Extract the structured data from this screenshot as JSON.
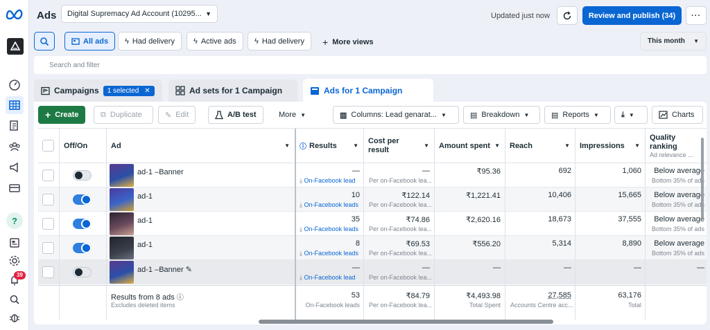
{
  "header": {
    "title": "Ads",
    "account": "Digital Supremacy Ad Account (10295...",
    "updated": "Updated just now",
    "review_label": "Review and publish (34)",
    "more_label": "···"
  },
  "sidebar": {
    "notification_count": "39",
    "help_label": "?"
  },
  "views": {
    "chips": [
      "All ads",
      "Had delivery",
      "Active ads",
      "Had delivery"
    ],
    "more_views": "More views",
    "date_range": "This month"
  },
  "search": {
    "placeholder": "Search and filter"
  },
  "tabs": {
    "campaigns": "Campaigns",
    "selected": "1 selected",
    "adsets": "Ad sets for 1 Campaign",
    "ads": "Ads for 1 Campaign"
  },
  "toolbar": {
    "create": "Create",
    "duplicate": "Duplicate",
    "edit": "Edit",
    "ab_test": "A/B test",
    "more": "More",
    "columns": "Columns: Lead genarat...",
    "breakdown": "Breakdown",
    "reports": "Reports",
    "charts": "Charts"
  },
  "table": {
    "headers": {
      "off_on": "Off/On",
      "ad": "Ad",
      "results": "Results",
      "cost_per_result": "Cost per result",
      "amount_spent": "Amount spent",
      "reach": "Reach",
      "impressions": "Impressions",
      "quality": "Quality ranking",
      "quality_sub": "Ad relevance ..."
    },
    "rows": [
      {
        "on": false,
        "name": "ad-1 –Banner",
        "results": "—",
        "results_sub": "On-Facebook lead",
        "cpr": "—",
        "cpr_sub": "Per on-Facebook lea...",
        "spent": "₹95.36",
        "reach": "692",
        "impressions": "1,060",
        "quality": "Below average",
        "quality_sub": "Bottom 35% of ads"
      },
      {
        "on": true,
        "name": "ad-1",
        "results": "10",
        "results_sub": "On-Facebook leads",
        "cpr": "₹122.14",
        "cpr_sub": "Per on-Facebook lea...",
        "spent": "₹1,221.41",
        "reach": "10,406",
        "impressions": "15,665",
        "quality": "Below average",
        "quality_sub": "Bottom 35% of ads"
      },
      {
        "on": true,
        "name": "ad-1",
        "results": "35",
        "results_sub": "On-Facebook leads",
        "cpr": "₹74.86",
        "cpr_sub": "Per on-Facebook lea...",
        "spent": "₹2,620.16",
        "reach": "18,673",
        "impressions": "37,555",
        "quality": "Below average",
        "quality_sub": "Bottom 35% of ads"
      },
      {
        "on": true,
        "name": "ad-1",
        "results": "8",
        "results_sub": "On-Facebook leads",
        "cpr": "₹69.53",
        "cpr_sub": "Per on-Facebook lea...",
        "spent": "₹556.20",
        "reach": "5,314",
        "impressions": "8,890",
        "quality": "Below average",
        "quality_sub": "Bottom 35% of ads"
      },
      {
        "on": false,
        "name": "ad-1 –Banner",
        "results": "—",
        "results_sub": "On-Facebook lead",
        "cpr": "—",
        "cpr_sub": "Per on-Facebook lea...",
        "spent": "—",
        "reach": "—",
        "impressions": "—",
        "quality": "—",
        "quality_sub": ""
      }
    ],
    "totals": {
      "label": "Results from 8 ads",
      "label_sub": "Excludes deleted items",
      "results": "53",
      "results_sub": "On-Facebook leads",
      "cpr": "₹84.79",
      "cpr_sub": "Per on-Facebook lea...",
      "spent": "₹4,493.98",
      "spent_sub": "Total Spent",
      "reach": "27,585",
      "reach_sub": "Accounts Centre acc...",
      "impressions": "63,176",
      "impressions_sub": "Total"
    }
  },
  "colors": {
    "accent": "#0a66d2",
    "create": "#1e7a44",
    "badge": "#e41e3f"
  }
}
